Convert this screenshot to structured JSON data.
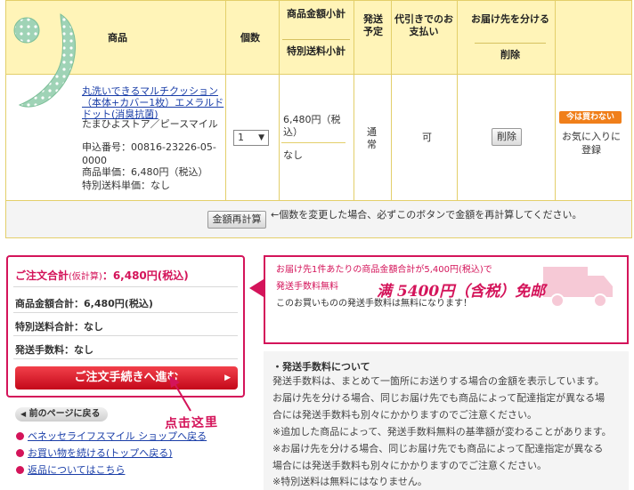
{
  "cart": {
    "headers": {
      "product": "商品",
      "quantity": "個数",
      "subtotal": "商品金額小計",
      "special_shipping": "特別送料小計",
      "ship_plan": "発送予定",
      "cod": "代引きでのお支払い",
      "split_delivery": "お届け先を分ける",
      "delete": "削除"
    },
    "item": {
      "name": "丸洗いできるマルチクッション（本体+カバー1枚）エメラルドドット(消臭抗菌)",
      "store": "たまひよストア／ピースマイル",
      "order_no": "申込番号：00816-23226-05-0000",
      "unit_price": "商品単価：6,480円（税込）",
      "special_unit": "特別送料単価：なし",
      "quantity": "1",
      "subtotal": "6,480円（税込）",
      "special_shipping": "なし",
      "ship_plan": "通常",
      "cod": "可",
      "delete_label": "削除",
      "badge": "今は買わない",
      "favorite": "お気に入りに登録"
    },
    "recalc": {
      "button": "金額再計算",
      "note": "←個数を変更した場合、必ずこのボタンで金額を再計算してください。"
    }
  },
  "summary": {
    "title": "ご注文合計",
    "title_note": "(仮計算)",
    "title_value": "：6,480円(税込)",
    "lines": [
      "商品金額合計：6,480円(税込)",
      "特別送料合計：なし",
      "発送手数料：なし"
    ],
    "order_button": "ご注文手続きへ進む",
    "back_button": "前のページに戻る",
    "links": [
      "ベネッセライフスマイル ショップへ戻る",
      "お買い物を続ける(トップへ戻る)",
      "返品についてはこちら"
    ],
    "annotation": "点击这里"
  },
  "notice": {
    "line1": "お届け先1件あたりの商品金額合計が5,400円(税込)で",
    "line2": "発送手数料無料",
    "line3": "このお買いものの発送手数料は無料になります！",
    "annotation": "满 5400円（含税）免邮"
  },
  "fee_info": {
    "title": "・発送手数料について",
    "lines": [
      "発送手数料は、まとめて一箇所にお送りする場合の金額を表示しています。",
      "お届け先を分ける場合、同じお届け先でも商品によって配達指定が異なる場",
      "合には発送手数料も別々にかかりますのでご注意ください。",
      "※追加した商品によって、発送手数料無料の基準額が変わることがあります。",
      "※お届け先を分ける場合、同じお届け先でも商品によって配達指定が異なる",
      "場合には発送手数料も別々にかかりますのでご注意ください。",
      "※特別送料は無料にはなりません。"
    ]
  },
  "colors": {
    "header_bg": "#fff4b8",
    "accent": "#d4145a",
    "link": "#1a3ea8",
    "order_button": "#d9101f",
    "badge": "#f07f1a"
  }
}
